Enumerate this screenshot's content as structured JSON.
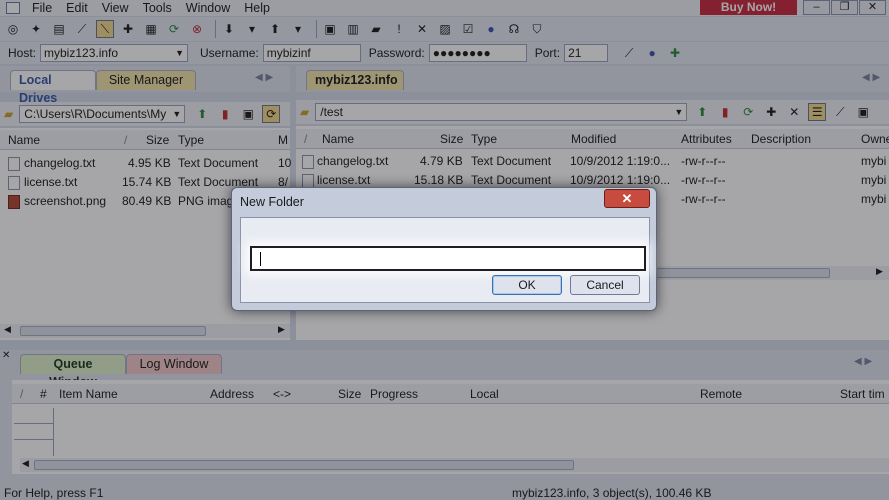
{
  "menubar": {
    "items": [
      "File",
      "Edit",
      "View",
      "Tools",
      "Window",
      "Help"
    ],
    "buy_now": "Buy Now!"
  },
  "connection": {
    "host_label": "Host:",
    "host_value": "mybiz123.info",
    "username_label": "Username:",
    "username_value": "mybizinf",
    "password_label": "Password:",
    "password_value": "●●●●●●●●",
    "port_label": "Port:",
    "port_value": "21"
  },
  "local": {
    "tabs": [
      "Local Drives",
      "Site Manager"
    ],
    "path": "C:\\Users\\R\\Documents\\My",
    "columns": [
      "Name",
      "Size",
      "Type",
      "M"
    ],
    "rows": [
      {
        "name": "changelog.txt",
        "size": "4.95 KB",
        "type": "Text Document",
        "mod": "10"
      },
      {
        "name": "license.txt",
        "size": "15.74 KB",
        "type": "Text Document",
        "mod": "8/"
      },
      {
        "name": "screenshot.png",
        "size": "80.49 KB",
        "type": "PNG imag",
        "mod": ""
      }
    ]
  },
  "remote": {
    "tab": "mybiz123.info",
    "path": "/test",
    "columns": [
      "Name",
      "Size",
      "Type",
      "Modified",
      "Attributes",
      "Description",
      "Owne"
    ],
    "rows": [
      {
        "name": "changelog.txt",
        "size": "4.79 KB",
        "type": "Text Document",
        "modified": "10/9/2012 1:19:0...",
        "attributes": "-rw-r--r--",
        "owner": "mybi"
      },
      {
        "name": "license.txt",
        "size": "15.18 KB",
        "type": "Text Document",
        "modified": "10/9/2012 1:19:0...",
        "attributes": "-rw-r--r--",
        "owner": "mybi"
      },
      {
        "name": "",
        "size": "",
        "type": "",
        "modified": "",
        "attributes": "-rw-r--r--",
        "owner": "mybi"
      }
    ]
  },
  "queue": {
    "tabs": [
      "Queue Window",
      "Log Window"
    ],
    "columns": [
      "/",
      "#",
      "Item Name",
      "Address",
      "<->",
      "Size",
      "Progress",
      "Local",
      "Remote",
      "Start tim"
    ]
  },
  "status": {
    "left": "For Help, press F1",
    "right": "mybiz123.info, 3 object(s), 100.46 KB"
  },
  "dialog": {
    "title": "New Folder",
    "close": "✕",
    "input_value": "",
    "ok": "OK",
    "cancel": "Cancel"
  }
}
